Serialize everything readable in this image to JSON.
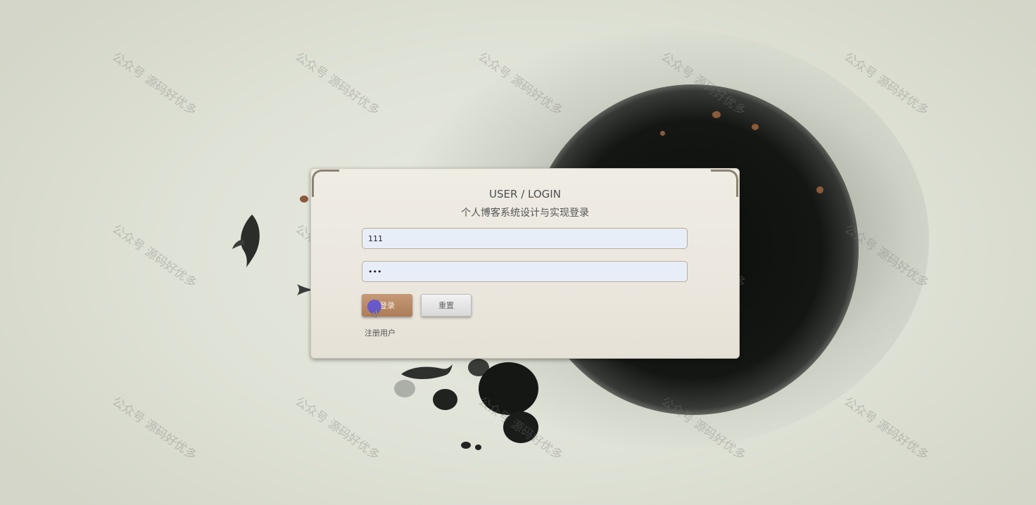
{
  "login": {
    "title": "USER / LOGIN",
    "subtitle": "个人博客系统设计与实现登录",
    "username_value": "111",
    "password_value": "123",
    "login_label": "登录",
    "reset_label": "重置",
    "register_label": "注册用户"
  },
  "watermark": {
    "text": "公众号 源码好优多"
  },
  "colors": {
    "login_button": "#b5845f",
    "panel_background": "#ebe7de",
    "input_background": "#e8eef8"
  },
  "icons": {
    "cursor": "pointer-hand-icon",
    "fish": "koi-fish-icon"
  }
}
